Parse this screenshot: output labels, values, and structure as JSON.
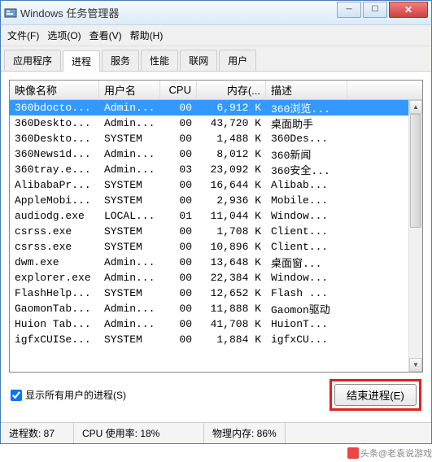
{
  "title": "Windows 任务管理器",
  "menu": {
    "file": "文件(F)",
    "options": "选项(O)",
    "view": "查看(V)",
    "help": "帮助(H)"
  },
  "tabs": {
    "apps": "应用程序",
    "processes": "进程",
    "services": "服务",
    "performance": "性能",
    "network": "联网",
    "users": "用户"
  },
  "columns": {
    "name": "映像名称",
    "user": "用户名",
    "cpu": "CPU",
    "mem": "内存(...",
    "desc": "描述"
  },
  "rows": [
    {
      "name": "360bdocto...",
      "user": "Admin...",
      "cpu": "00",
      "mem": "6,912 K",
      "desc": "360浏览...",
      "selected": true
    },
    {
      "name": "360Deskto...",
      "user": "Admin...",
      "cpu": "00",
      "mem": "43,720 K",
      "desc": "桌面助手"
    },
    {
      "name": "360Deskto...",
      "user": "SYSTEM",
      "cpu": "00",
      "mem": "1,488 K",
      "desc": "360Des..."
    },
    {
      "name": "360News1d...",
      "user": "Admin...",
      "cpu": "00",
      "mem": "8,012 K",
      "desc": "360新闻"
    },
    {
      "name": "360tray.e...",
      "user": "Admin...",
      "cpu": "03",
      "mem": "23,092 K",
      "desc": "360安全..."
    },
    {
      "name": "AlibabaPr...",
      "user": "SYSTEM",
      "cpu": "00",
      "mem": "16,644 K",
      "desc": "Alibab..."
    },
    {
      "name": "AppleMobi...",
      "user": "SYSTEM",
      "cpu": "00",
      "mem": "2,936 K",
      "desc": "Mobile..."
    },
    {
      "name": "audiodg.exe",
      "user": "LOCAL...",
      "cpu": "01",
      "mem": "11,044 K",
      "desc": "Window..."
    },
    {
      "name": "csrss.exe",
      "user": "SYSTEM",
      "cpu": "00",
      "mem": "1,708 K",
      "desc": "Client..."
    },
    {
      "name": "csrss.exe",
      "user": "SYSTEM",
      "cpu": "00",
      "mem": "10,896 K",
      "desc": "Client..."
    },
    {
      "name": "dwm.exe",
      "user": "Admin...",
      "cpu": "00",
      "mem": "13,648 K",
      "desc": "桌面窗..."
    },
    {
      "name": "explorer.exe",
      "user": "Admin...",
      "cpu": "00",
      "mem": "22,384 K",
      "desc": "Window..."
    },
    {
      "name": "FlashHelp...",
      "user": "SYSTEM",
      "cpu": "00",
      "mem": "12,652 K",
      "desc": "Flash ..."
    },
    {
      "name": "GaomonTab...",
      "user": "Admin...",
      "cpu": "00",
      "mem": "11,888 K",
      "desc": "Gaomon驱动"
    },
    {
      "name": "Huion Tab...",
      "user": "Admin...",
      "cpu": "00",
      "mem": "41,708 K",
      "desc": "HuionT..."
    },
    {
      "name": "igfxCUISe...",
      "user": "SYSTEM",
      "cpu": "00",
      "mem": "1,884 K",
      "desc": "igfxCU..."
    }
  ],
  "checkbox_label": "显示所有用户的进程(S)",
  "end_button": "结束进程(E)",
  "status": {
    "procs": "进程数: 87",
    "cpu": "CPU 使用率: 18%",
    "mem": "物理内存: 86%"
  },
  "footer": "头条@老袁说游戏"
}
